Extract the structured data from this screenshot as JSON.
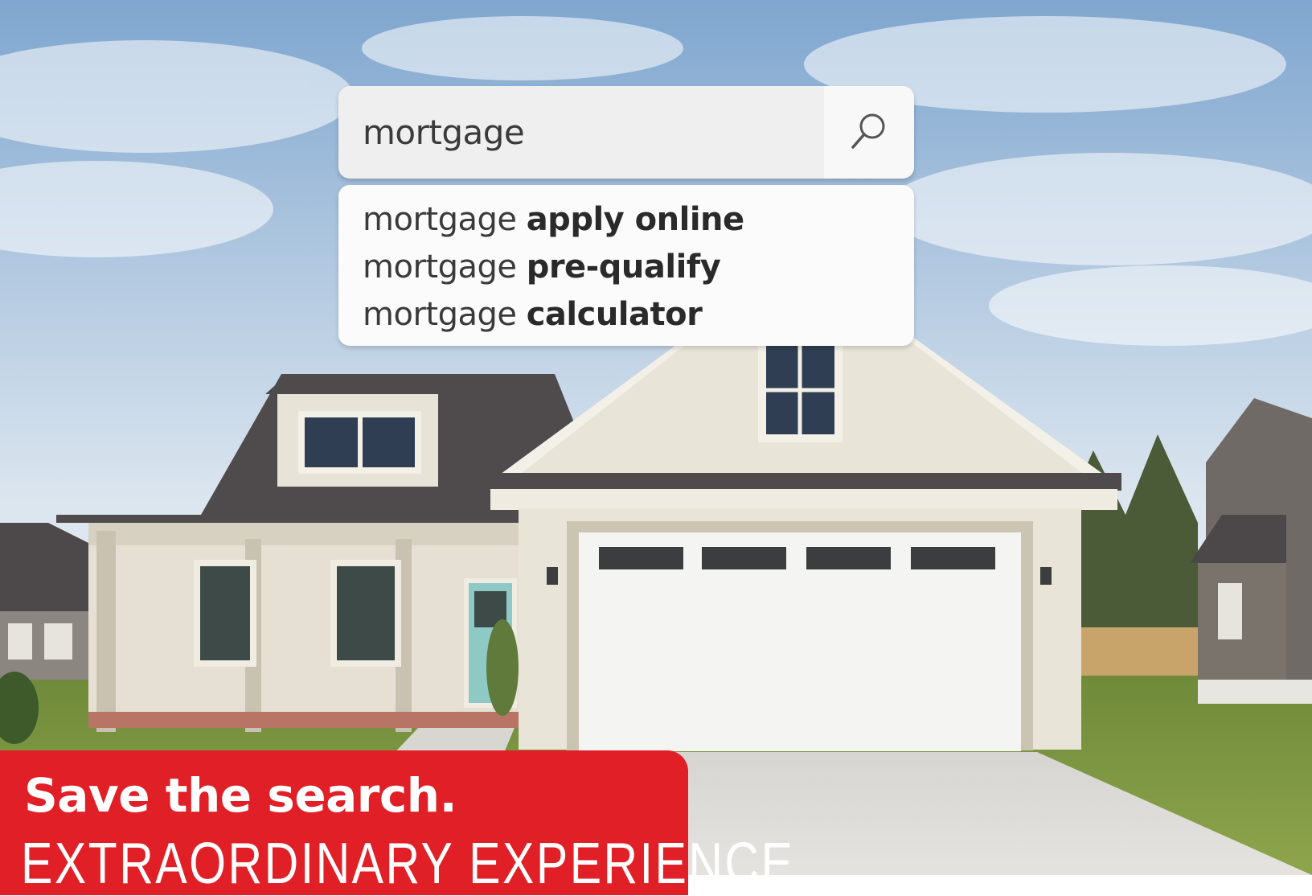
{
  "search": {
    "query": "mortgage",
    "icon": "search-icon",
    "suggestions": [
      {
        "prefix": "mortgage",
        "completion": "apply online"
      },
      {
        "prefix": "mortgage",
        "completion": "pre-qualify"
      },
      {
        "prefix": "mortgage",
        "completion": "calculator"
      }
    ]
  },
  "banner": {
    "headline": "Save the search.",
    "tagline": "EXTRAORDINARY EXPERIENCE",
    "color": "#e01f26"
  },
  "colors": {
    "sky": "#8fb4d8",
    "roof": "#4f4a4c",
    "siding": "#e9e4d8",
    "garage_door": "#f4f4f2",
    "lawn": "#7f9a43",
    "door": "#8fc9c6"
  }
}
